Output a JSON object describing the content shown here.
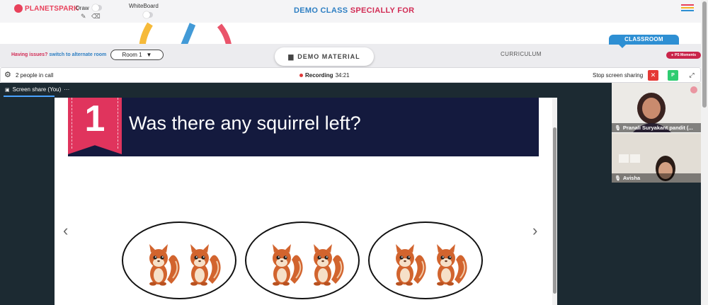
{
  "header": {
    "brand": "PLANETSPARK",
    "draw_label": "Draw",
    "whiteboard_label": "WhiteBoard",
    "title_part1": "DEMO CLASS",
    "title_part2": "SPECIALLY FOR",
    "brand_color": "#e8415b",
    "title_color_1": "#2e7fc3",
    "title_color_2": "#d22c55"
  },
  "toolbar": {
    "issues_text": "Having issues?",
    "alt_room_link": "switch to alternate room",
    "room_select_value": "Room 1",
    "demo_material_label": "DEMO MATERIAL",
    "curriculum_label": "CURRICULUM",
    "classroom_label": "CLASSROOM",
    "ps_moments_label": "PS Moments"
  },
  "call": {
    "people_count": "2 people in call",
    "recording_label": "Recording",
    "recording_time": "34:21",
    "stop_share_label": "Stop screen sharing",
    "participant_initial": "P"
  },
  "stage": {
    "share_label": "Screen share (You)",
    "slide_number": "1",
    "slide_question": "Was there any squirrel left?",
    "groups": [
      {
        "squirrels": 2
      },
      {
        "squirrels": 2
      },
      {
        "squirrels": 2
      }
    ]
  },
  "participants": [
    {
      "name": "Pranali Suryakant pandit (..."
    },
    {
      "name": "Avisha"
    }
  ],
  "icons": {
    "settings": "gear-icon",
    "folder": "folder-icon",
    "close": "close-icon",
    "expand": "expand-icon",
    "mic": "mic-icon",
    "menu": "hamburger-menu-icon"
  }
}
